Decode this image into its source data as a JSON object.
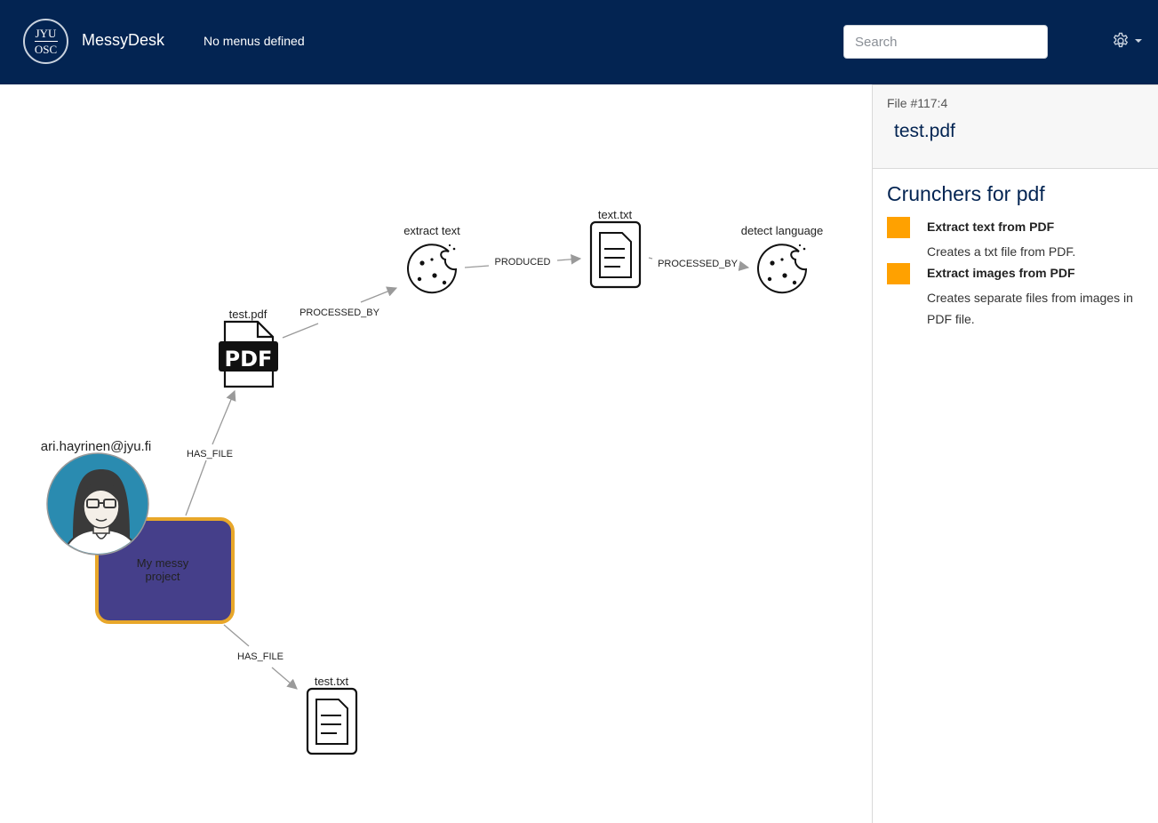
{
  "header": {
    "logo_line1": "JYU",
    "logo_line2": "OSC",
    "brand": "MessyDesk",
    "menus_text": "No menus defined",
    "search_placeholder": "Search",
    "colors": {
      "navbar": "#032452",
      "accent": "#ffa100"
    }
  },
  "graph": {
    "nodes": {
      "user": "ari.hayrinen@jyu.fi",
      "project": "My messy project",
      "pdf_file": "test.pdf",
      "extract_text": "extract text",
      "produced_txt": "text.txt",
      "detect_language": "detect language",
      "uploaded_txt": "test.txt"
    },
    "edges": {
      "user_project_to_pdf": "HAS_FILE",
      "pdf_to_extract": "PROCESSED_BY",
      "extract_to_txt": "PRODUCED",
      "txt_to_detect": "PROCESSED_BY",
      "project_to_txt": "HAS_FILE"
    },
    "icons": {
      "user": "user-avatar-icon",
      "pdf": "pdf-file-icon",
      "process": "cookie-icon",
      "text": "text-file-icon"
    }
  },
  "panel": {
    "file_id": "File #117:4",
    "file_name": "test.pdf",
    "crunchers_title": "Crunchers for pdf",
    "crunchers": [
      {
        "name": "Extract text from PDF",
        "description": "Creates a txt file from PDF."
      },
      {
        "name": "Extract images from PDF",
        "description": "Creates separate files from images in PDF file."
      }
    ]
  }
}
